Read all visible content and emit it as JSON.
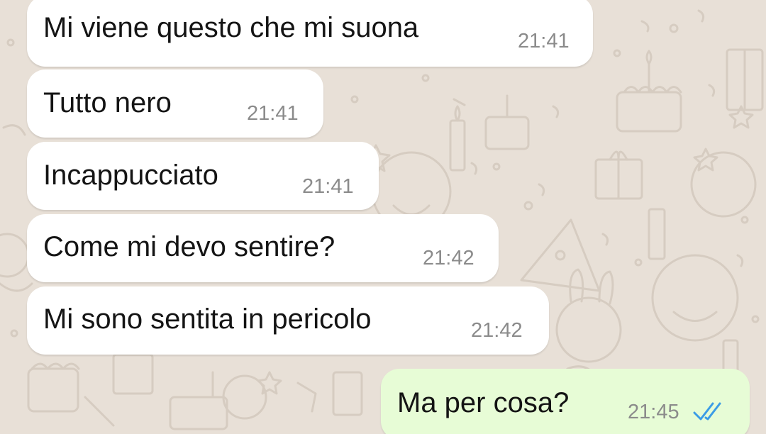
{
  "chat": {
    "background_color": "#e8e0d7",
    "incoming_bubble_color": "#ffffff",
    "outgoing_bubble_color": "#e7fcd6",
    "read_tick_color": "#3b9ce6",
    "messages": [
      {
        "direction": "incoming",
        "text": "Mi viene questo che mi suona",
        "time": "21:41"
      },
      {
        "direction": "incoming",
        "text": "Tutto nero",
        "time": "21:41"
      },
      {
        "direction": "incoming",
        "text": "Incappucciato",
        "time": "21:41"
      },
      {
        "direction": "incoming",
        "text": "Come mi devo sentire?",
        "time": "21:42"
      },
      {
        "direction": "incoming",
        "text": "Mi sono sentita in pericolo",
        "time": "21:42"
      },
      {
        "direction": "outgoing",
        "text": "Ma per cosa?",
        "time": "21:45",
        "status_icon": "double-check-read-icon"
      }
    ]
  }
}
